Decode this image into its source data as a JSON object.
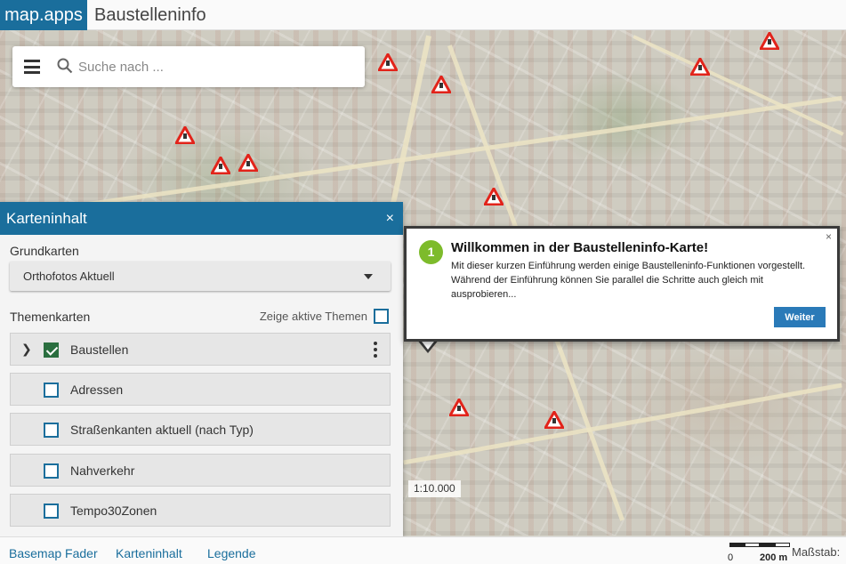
{
  "app": {
    "brand": "map.apps",
    "title": "Baustelleninfo"
  },
  "search": {
    "placeholder": "Suche nach ..."
  },
  "panel": {
    "title": "Karteninhalt",
    "close": "×",
    "basemaps_label": "Grundkarten",
    "basemap_selected": "Orthofotos Aktuell",
    "themes_label": "Themenkarten",
    "show_active_label": "Zeige aktive Themen",
    "layers": [
      {
        "label": "Baustellen",
        "checked": true,
        "expandable": true
      },
      {
        "label": "Adressen",
        "checked": false
      },
      {
        "label": "Straßenkanten aktuell (nach Typ)",
        "checked": false
      },
      {
        "label": "Nahverkehr",
        "checked": false
      },
      {
        "label": "Tempo30Zonen",
        "checked": false
      }
    ]
  },
  "tour": {
    "step": "1",
    "title": "Willkommen in der Baustelleninfo-Karte!",
    "text": "Mit dieser kurzen Einführung werden einige Baustelleninfo-Funktionen vorgestellt. Während der Einführung können Sie parallel die Schritte auch gleich mit ausprobieren...",
    "close": "×",
    "next": "Weiter"
  },
  "map": {
    "scale": "1:10.000",
    "marker_icon": "construction-warning-icon"
  },
  "footer": {
    "links": [
      "Basemap Fader",
      "Karteninhalt",
      "Legende"
    ],
    "scalebar_start": "0",
    "scalebar_end": "200 m",
    "scale_label": "Maßstab:"
  },
  "colors": {
    "brand": "#1a6e9c",
    "step_badge": "#7dbb2b",
    "warning": "#e2231a"
  }
}
